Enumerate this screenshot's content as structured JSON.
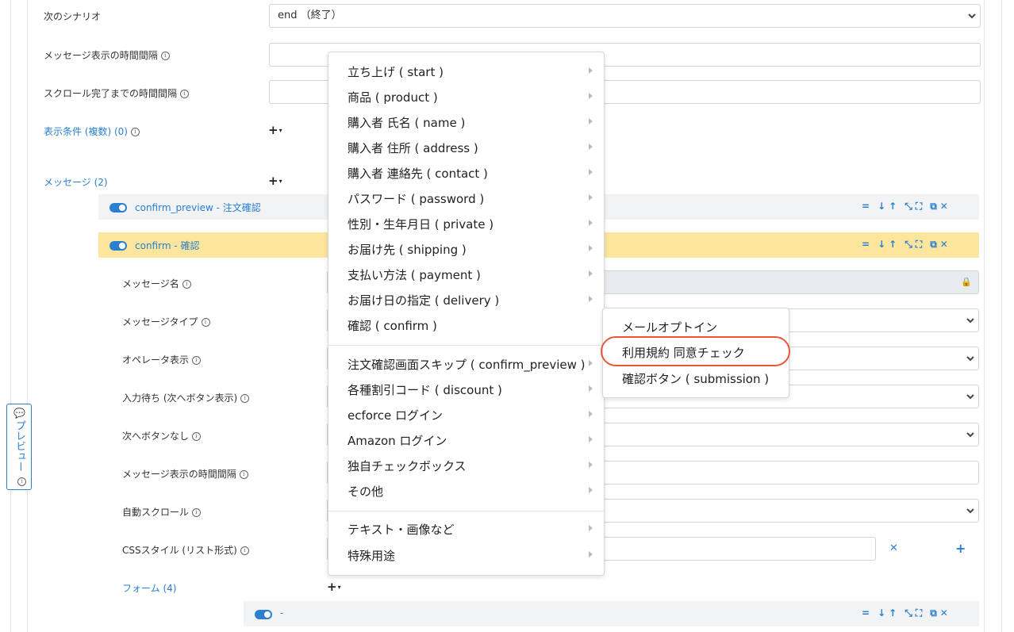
{
  "form": {
    "next_scenario_label": "次のシナリオ",
    "next_scenario_value": "end （終了）",
    "msg_interval_label": "メッセージ表示の時間間隔",
    "scroll_interval_label": "スクロール完了までの時間間隔",
    "display_conditions_link": "表示条件 (複数) (0)",
    "messages_link": "メッセージ (2)"
  },
  "messages": [
    {
      "text": "confirm_preview - 注文確認",
      "highlighted": false
    },
    {
      "text": "confirm - 確認",
      "highlighted": true
    }
  ],
  "detail": {
    "message_name_label": "メッセージ名",
    "message_type_label": "メッセージタイプ",
    "operator_label": "オペレータ表示",
    "input_wait_label": "入力待ち (次へボタン表示)",
    "no_next_label": "次へボタンなし",
    "msg_interval_label": "メッセージ表示の時間間隔",
    "auto_scroll_label": "自動スクロール",
    "css_label": "CSSスタイル (リスト形式)",
    "form_link": "フォーム (4)",
    "form_row_text": "-"
  },
  "preview_tab": {
    "label": "プレビュー"
  },
  "menu": {
    "group1": [
      "立ち上げ ( start )",
      "商品 ( product )",
      "購入者 氏名 ( name )",
      "購入者 住所 ( address )",
      "購入者 連絡先 ( contact )",
      "パスワード ( password )",
      "性別・生年月日 ( private )",
      "お届け先 ( shipping )",
      "支払い方法 ( payment )",
      "お届け日の指定 ( delivery )",
      "確認 ( confirm )"
    ],
    "group2": [
      "注文確認画面スキップ ( confirm_preview )",
      "各種割引コード ( discount )",
      "ecforce ログイン",
      "Amazon ログイン",
      "独自チェックボックス",
      "その他"
    ],
    "group3": [
      "テキスト・画像など",
      "特殊用途"
    ]
  },
  "submenu": {
    "items": [
      "メールオプトイン",
      "利用規約 同意チェック",
      "確認ボタン ( submission )"
    ],
    "highlight_color": "#e8573a"
  },
  "colors": {
    "accent": "#2b7fd1",
    "highlight_row": "#fce59c"
  }
}
